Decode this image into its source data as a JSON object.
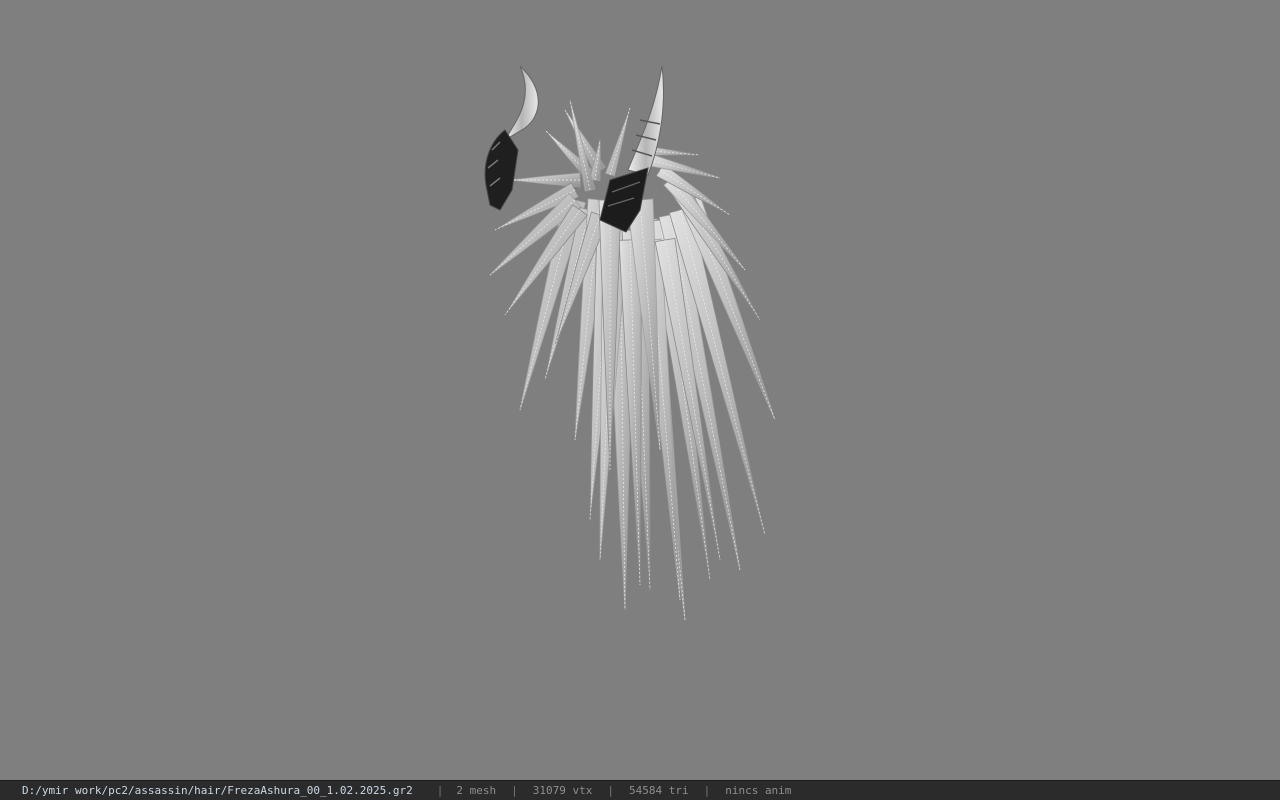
{
  "viewport": {
    "background": "#7f7f7f",
    "model_label": "FrezaAshura_00_1.02.2025.gr2"
  },
  "statusbar": {
    "file_path": "D:/ymir work/pc2/assassin/hair/FrezaAshura_00_1.02.2025.gr2",
    "separator": "|",
    "mesh_count": "2 mesh",
    "vertex_count": "31079 vtx",
    "triangle_count": "54584 tri",
    "anim_status": "nincs anim"
  },
  "colors": {
    "statusbar_bg": "#2b2b2b",
    "path_text": "#c9d8e6",
    "info_text": "#8e8e8e",
    "hair_light": "#d8d8d8",
    "hair_dark": "#9a9a9a",
    "horn_dark": "#1e1e1e"
  }
}
